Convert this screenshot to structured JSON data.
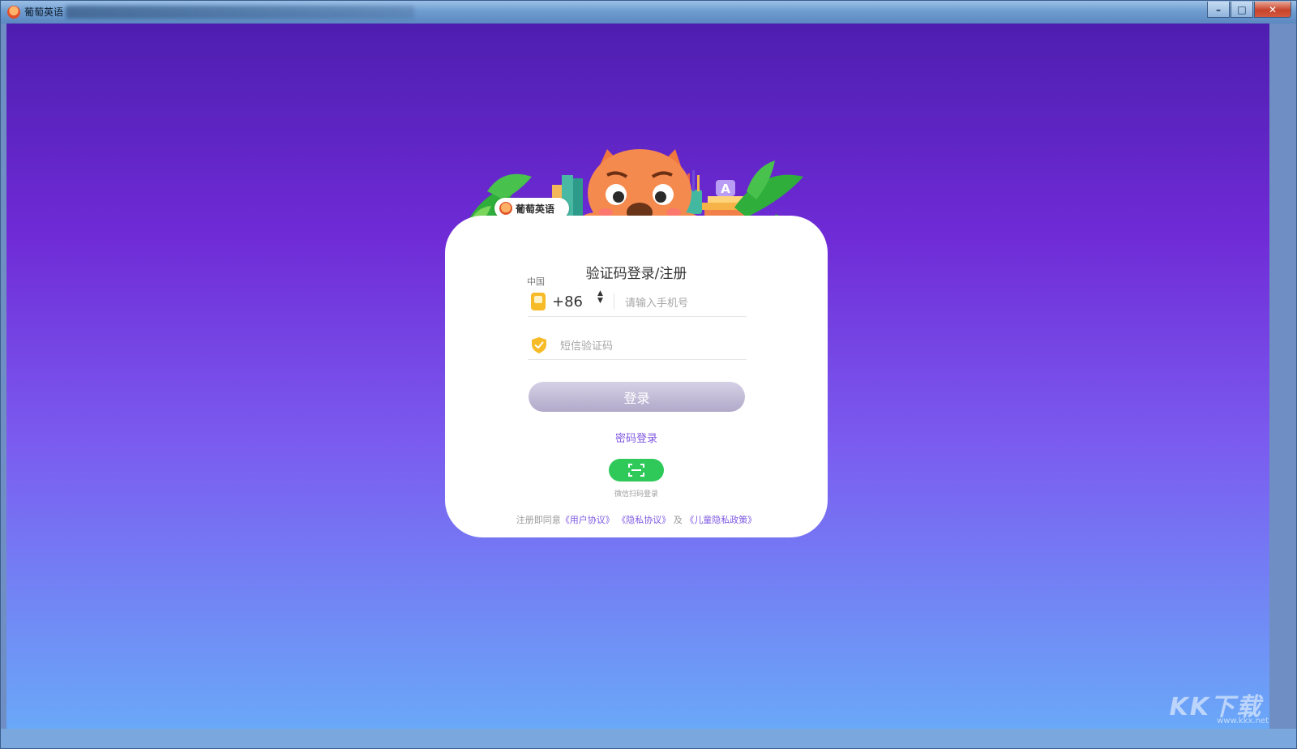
{
  "window": {
    "title": "葡萄英语",
    "controls": {
      "minimize": "–",
      "maximize": "□",
      "close": "✕"
    }
  },
  "brand": {
    "name": "葡萄英语"
  },
  "login": {
    "title": "验证码登录/注册",
    "country_label": "中国",
    "country_code": "+86",
    "phone_placeholder": "请输入手机号",
    "sms_placeholder": "短信验证码",
    "login_button": "登录",
    "password_login_link": "密码登录",
    "wechat_label": "微信扫码登录",
    "agreement": {
      "prefix": "注册即同意",
      "user_agreement": "《用户协议》",
      "privacy_agreement": "《隐私协议》",
      "and": "及",
      "child_privacy": "《儿童隐私政策》"
    }
  },
  "watermark": {
    "text": "KK下载",
    "url": "www.kkx.net"
  },
  "colors": {
    "accent": "#7e57e2",
    "wechat_green": "#2fc95a",
    "icon_yellow": "#f6bb27",
    "bg_top": "#4e1eb0",
    "bg_bottom": "#6aa8f8"
  }
}
